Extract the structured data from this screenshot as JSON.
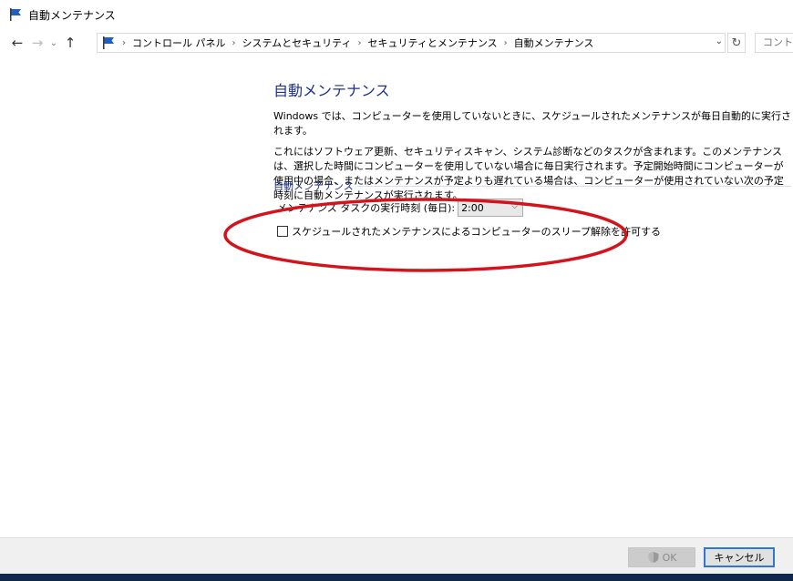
{
  "window": {
    "title": "自動メンテナンス",
    "icon": "maintenance-flag-icon"
  },
  "nav": {
    "back_icon": "←",
    "forward_icon": "→",
    "recent_icon": "⌄",
    "up_icon": "↑",
    "breadcrumbs": [
      "コントロール パネル",
      "システムとセキュリティ",
      "セキュリティとメンテナンス",
      "自動メンテナンス"
    ],
    "separator": "›",
    "dropdown_icon": "⌄",
    "refresh_icon": "↻",
    "search_placeholder": "コントロ"
  },
  "main": {
    "title": "自動メンテナンス",
    "description_1": "Windows では、コンピューターを使用していないときに、スケジュールされたメンテナンスが毎日自動的に実行されます。",
    "description_2": "これにはソフトウェア更新、セキュリティスキャン、システム診断などのタスクが含まれます。このメンテナンスは、選択した時間にコンピューターを使用していない場合に毎日実行されます。予定開始時間にコンピューターが使用中の場合、またはメンテナンスが予定よりも遅れている場合は、コンピューターが使用されていない次の予定時刻に自動メンテナンスが実行されます。",
    "section_title": "自動メンテナンス",
    "time_label": "メンテナンス タスクの実行時刻 (毎日):",
    "time_value": "2:00",
    "wake_checkbox_label": "スケジュールされたメンテナンスによるコンピューターのスリープ解除を許可する",
    "wake_checkbox_checked": false
  },
  "buttons": {
    "ok_label": "OK",
    "cancel_label": "キャンセル"
  },
  "colors": {
    "link_blue": "#1e3287",
    "annotation_red": "#d4141c",
    "focus_blue": "#2b78d6"
  }
}
